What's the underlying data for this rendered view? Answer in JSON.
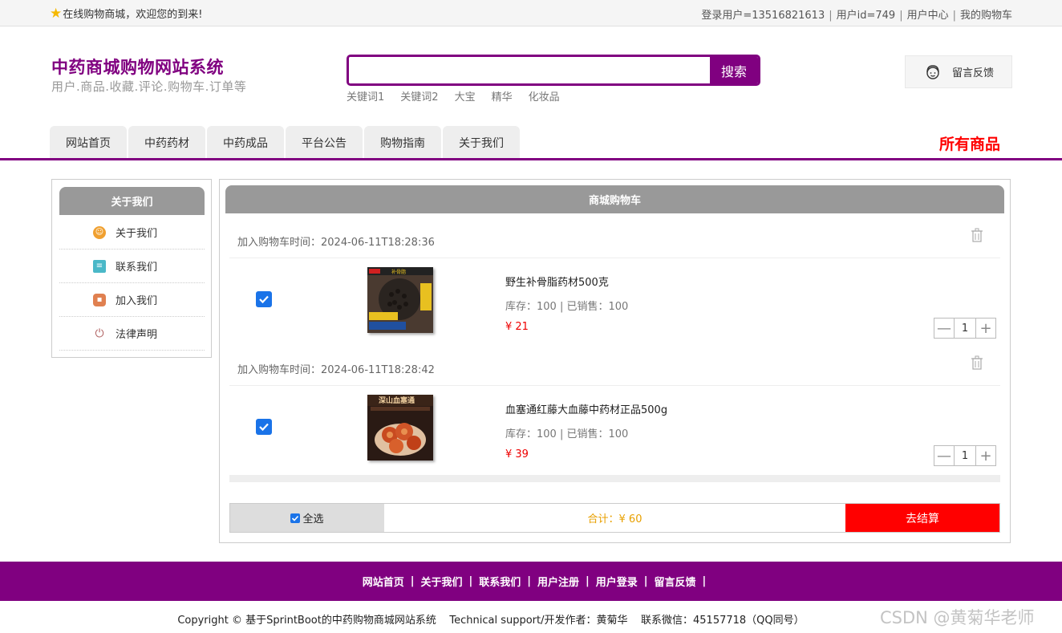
{
  "topbar": {
    "welcome": "在线购物商城，欢迎您的到来!",
    "user": "登录用户=13516821613",
    "user_id": "用户id=749",
    "user_center": "用户中心",
    "my_cart": "我的购物车"
  },
  "header": {
    "title": "中药商城购物网站系统",
    "subtitle": "用户.商品.收藏.评论.购物车.订单等",
    "search": {
      "value": "",
      "button": "搜索"
    },
    "keywords": [
      "关键词1",
      "关键词2",
      "大宝",
      "精华",
      "化妆品"
    ],
    "feedback": "留言反馈"
  },
  "nav": {
    "tabs": [
      "网站首页",
      "中药药材",
      "中药成品",
      "平台公告",
      "购物指南",
      "关于我们"
    ],
    "all_goods": "所有商品"
  },
  "sidebar": {
    "title": "关于我们",
    "items": [
      "关于我们",
      "联系我们",
      "加入我们",
      "法律声明"
    ]
  },
  "cart": {
    "title": "商城购物车",
    "items": [
      {
        "added_time": "加入购物车时间：2024-06-11T18:28:36",
        "name": "野生补骨脂药材500克",
        "stock": "库存：100 | 已销售：100",
        "price": "¥ 21",
        "qty": "1",
        "checked": true,
        "image_text": "补骨脂"
      },
      {
        "added_time": "加入购物车时间：2024-06-11T18:28:42",
        "name": "血塞通红藤大血藤中药材正品500g",
        "stock": "库存：100 | 已销售：100",
        "price": "¥ 39",
        "qty": "1",
        "checked": true,
        "image_text": "深山血塞通"
      }
    ],
    "select_all": "全选",
    "total": "合计：¥ 60",
    "checkout": "去结算"
  },
  "footer": {
    "links": [
      "网站首页",
      "关于我们",
      "联系我们",
      "用户注册",
      "用户登录",
      "留言反馈"
    ],
    "copyright": "Copyright © 基于SprintBoot的中药购物商城网站系统    Technical support/开发作者：黄菊华    联系微信：45157718（QQ同号）",
    "watermark": "CSDN @黄菊华老师"
  },
  "colors": {
    "brand": "#800080",
    "accent_red": "#ff0000",
    "price_red": "#e00000",
    "total_orange": "#e8a000"
  },
  "icons": [
    "star-icon",
    "search-icon",
    "headset-icon",
    "trash-icon",
    "plus-icon",
    "minus-icon"
  ]
}
